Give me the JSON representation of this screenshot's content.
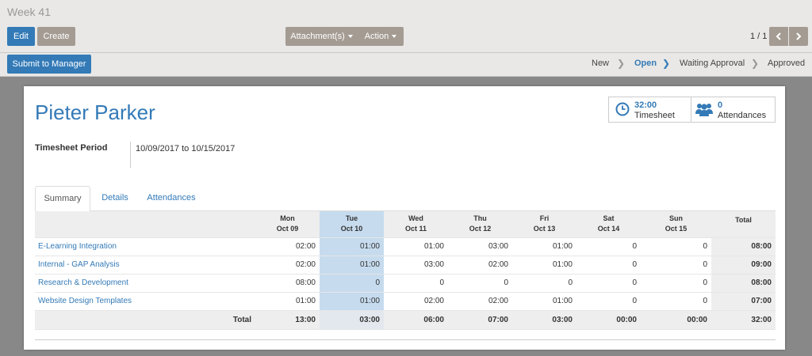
{
  "breadcrumb": "Week 41",
  "buttons": {
    "edit": "Edit",
    "create": "Create",
    "attachments": "Attachment(s)",
    "action": "Action",
    "submit": "Submit to Manager"
  },
  "pager": {
    "value": "1 / 1",
    "prev_icon": "chevron-left-icon",
    "next_icon": "chevron-right-icon"
  },
  "stages": [
    {
      "label": "New",
      "active": false
    },
    {
      "label": "Open",
      "active": true
    },
    {
      "label": "Waiting Approval",
      "active": false
    },
    {
      "label": "Approved",
      "active": false
    }
  ],
  "employee": "Pieter Parker",
  "smart_buttons": {
    "timesheet": {
      "value": "32:00",
      "label": "Timesheet",
      "icon": "clock-icon"
    },
    "attendances": {
      "value": "0",
      "label": "Attendances",
      "icon": "users-icon"
    }
  },
  "period": {
    "label": "Timesheet Period",
    "value": "10/09/2017 to 10/15/2017"
  },
  "tabs": [
    {
      "label": "Summary",
      "active": true
    },
    {
      "label": "Details",
      "active": false
    },
    {
      "label": "Attendances",
      "active": false
    }
  ],
  "grid": {
    "days": [
      {
        "day": "Mon",
        "date": "Oct 09"
      },
      {
        "day": "Tue",
        "date": "Oct 10"
      },
      {
        "day": "Wed",
        "date": "Oct 11"
      },
      {
        "day": "Thu",
        "date": "Oct 12"
      },
      {
        "day": "Fri",
        "date": "Oct 13"
      },
      {
        "day": "Sat",
        "date": "Oct 14"
      },
      {
        "day": "Sun",
        "date": "Oct 15"
      }
    ],
    "total_header": "Total",
    "rows": [
      {
        "project": "E-Learning Integration",
        "values": [
          "02:00",
          "01:00",
          "01:00",
          "03:00",
          "01:00",
          "0",
          "0"
        ],
        "total": "08:00"
      },
      {
        "project": "Internal - GAP Analysis",
        "values": [
          "02:00",
          "01:00",
          "03:00",
          "02:00",
          "01:00",
          "0",
          "0"
        ],
        "total": "09:00"
      },
      {
        "project": "Research & Development",
        "values": [
          "08:00",
          "0",
          "0",
          "0",
          "0",
          "0",
          "0"
        ],
        "total": "08:00"
      },
      {
        "project": "Website Design Templates",
        "values": [
          "01:00",
          "01:00",
          "02:00",
          "02:00",
          "01:00",
          "0",
          "0"
        ],
        "total": "07:00"
      }
    ],
    "footer": {
      "label": "Total",
      "values": [
        "13:00",
        "03:00",
        "06:00",
        "07:00",
        "03:00",
        "00:00",
        "00:00"
      ],
      "total": "32:00"
    },
    "highlight_index": 1
  },
  "colors": {
    "primary": "#337ab7",
    "secondary": "#a49c93",
    "highlight": "#c6dbee"
  }
}
